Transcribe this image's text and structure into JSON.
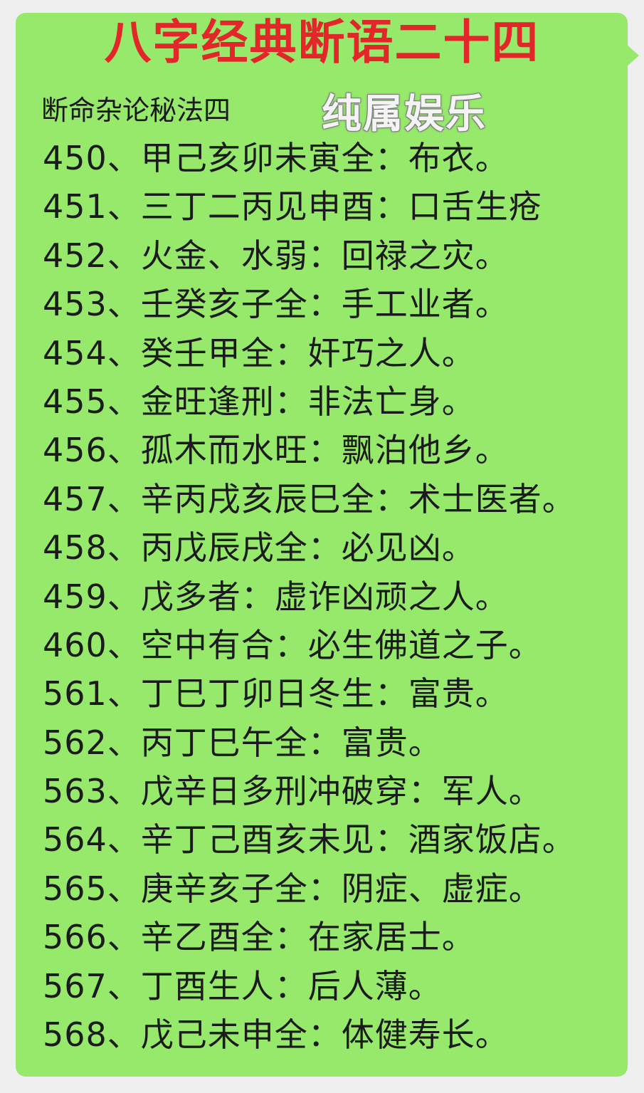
{
  "post": {
    "title": "八字经典断语二十四",
    "subtitle": "断命杂论秘法四",
    "watermark": "纯属娱乐",
    "lines": [
      "450、甲己亥卯未寅全：布衣。",
      "451、三丁二丙见申酉：口舌生疮",
      "452、火金、水弱：回禄之灾。",
      "453、壬癸亥子全：手工业者。",
      "454、癸壬甲全：奸巧之人。",
      "455、金旺逢刑：非法亡身。",
      "456、孤木而水旺：飘泊他乡。",
      "457、辛丙戌亥辰巳全：术士医者。",
      "458、丙戊辰戌全：必见凶。",
      "459、戊多者：虚诈凶顽之人。",
      "460、空中有合：必生佛道之子。",
      "561、丁巳丁卯日冬生：富贵。",
      "562、丙丁巳午全：富贵。",
      "563、戊辛日多刑冲破穿：军人。",
      "564、辛丁己酉亥未见：酒家饭店。",
      "565、庚辛亥子全：阴症、虚症。",
      "566、辛乙酉全：在家居士。",
      "567、丁酉生人：后人薄。",
      "568、戊己未申全：体健寿长。"
    ]
  },
  "colors": {
    "bubble": "#96e96b",
    "title": "#e3262a",
    "text": "#1b1b1b",
    "background": "#efefef"
  }
}
